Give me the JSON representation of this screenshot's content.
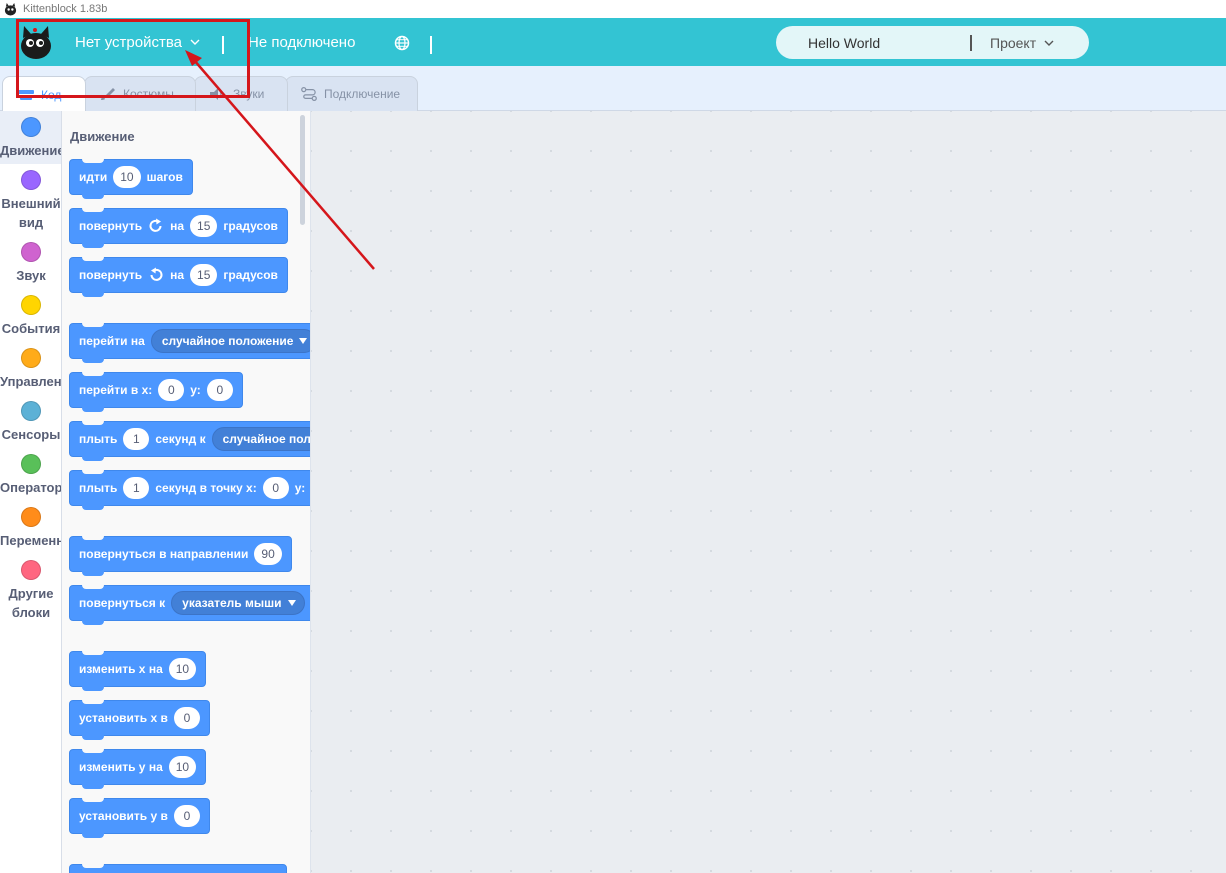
{
  "window": {
    "title": "Kittenblock 1.83b"
  },
  "menubar": {
    "device_menu": "Нет устройства",
    "connection_status": "Не подключено",
    "project_title": "Hello World",
    "project_menu": "Проект",
    "background_color": "#33c4d3"
  },
  "tabs": [
    {
      "label": "Код",
      "active": true
    },
    {
      "label": "Костюмы",
      "active": false
    },
    {
      "label": "Звуки",
      "active": false
    },
    {
      "label": "Подключение",
      "active": false
    }
  ],
  "categories": [
    {
      "label": "Движение",
      "color": "#4c97ff",
      "selected": true
    },
    {
      "label": "Внешний вид",
      "color": "#9966ff"
    },
    {
      "label": "Звук",
      "color": "#cf63cf"
    },
    {
      "label": "События",
      "color": "#ffd500"
    },
    {
      "label": "Управление",
      "color": "#ffab19"
    },
    {
      "label": "Сенсоры",
      "color": "#5cb1d6"
    },
    {
      "label": "Операторы",
      "color": "#59c059"
    },
    {
      "label": "Переменные",
      "color": "#ff8c1a"
    },
    {
      "label": "Другие блоки",
      "color": "#ff6680"
    }
  ],
  "flyout": {
    "heading": "Движение",
    "blocks": {
      "move": {
        "t1": "идти",
        "v1": "10",
        "t2": "шагов"
      },
      "turn_right": {
        "t1": "повернуть",
        "icon": "rotate-right-icon",
        "t2": "на",
        "v1": "15",
        "t3": "градусов"
      },
      "turn_left": {
        "t1": "повернуть",
        "icon": "rotate-left-icon",
        "t2": "на",
        "v1": "15",
        "t3": "градусов"
      },
      "goto": {
        "t1": "перейти на",
        "menu": "случайное положение"
      },
      "goto_xy": {
        "t1": "перейти в х:",
        "v1": "0",
        "t2": "у:",
        "v2": "0"
      },
      "glide": {
        "t1": "плыть",
        "v1": "1",
        "t2": "секунд к",
        "menu": "случайное пол"
      },
      "glide_xy": {
        "t1": "плыть",
        "v1": "1",
        "t2": "секунд в точку х:",
        "v2": "0",
        "t3": "у:"
      },
      "point_dir": {
        "t1": "повернуться в направлении",
        "v1": "90"
      },
      "point_towards": {
        "t1": "повернуться к",
        "menu": "указатель мыши"
      },
      "change_x": {
        "t1": "изменить х на",
        "v1": "10"
      },
      "set_x": {
        "t1": "установить х в",
        "v1": "0"
      },
      "change_y": {
        "t1": "изменить у на",
        "v1": "10"
      },
      "set_y": {
        "t1": "установить у в",
        "v1": "0"
      }
    }
  },
  "annotation": {
    "color": "#d5161b"
  }
}
